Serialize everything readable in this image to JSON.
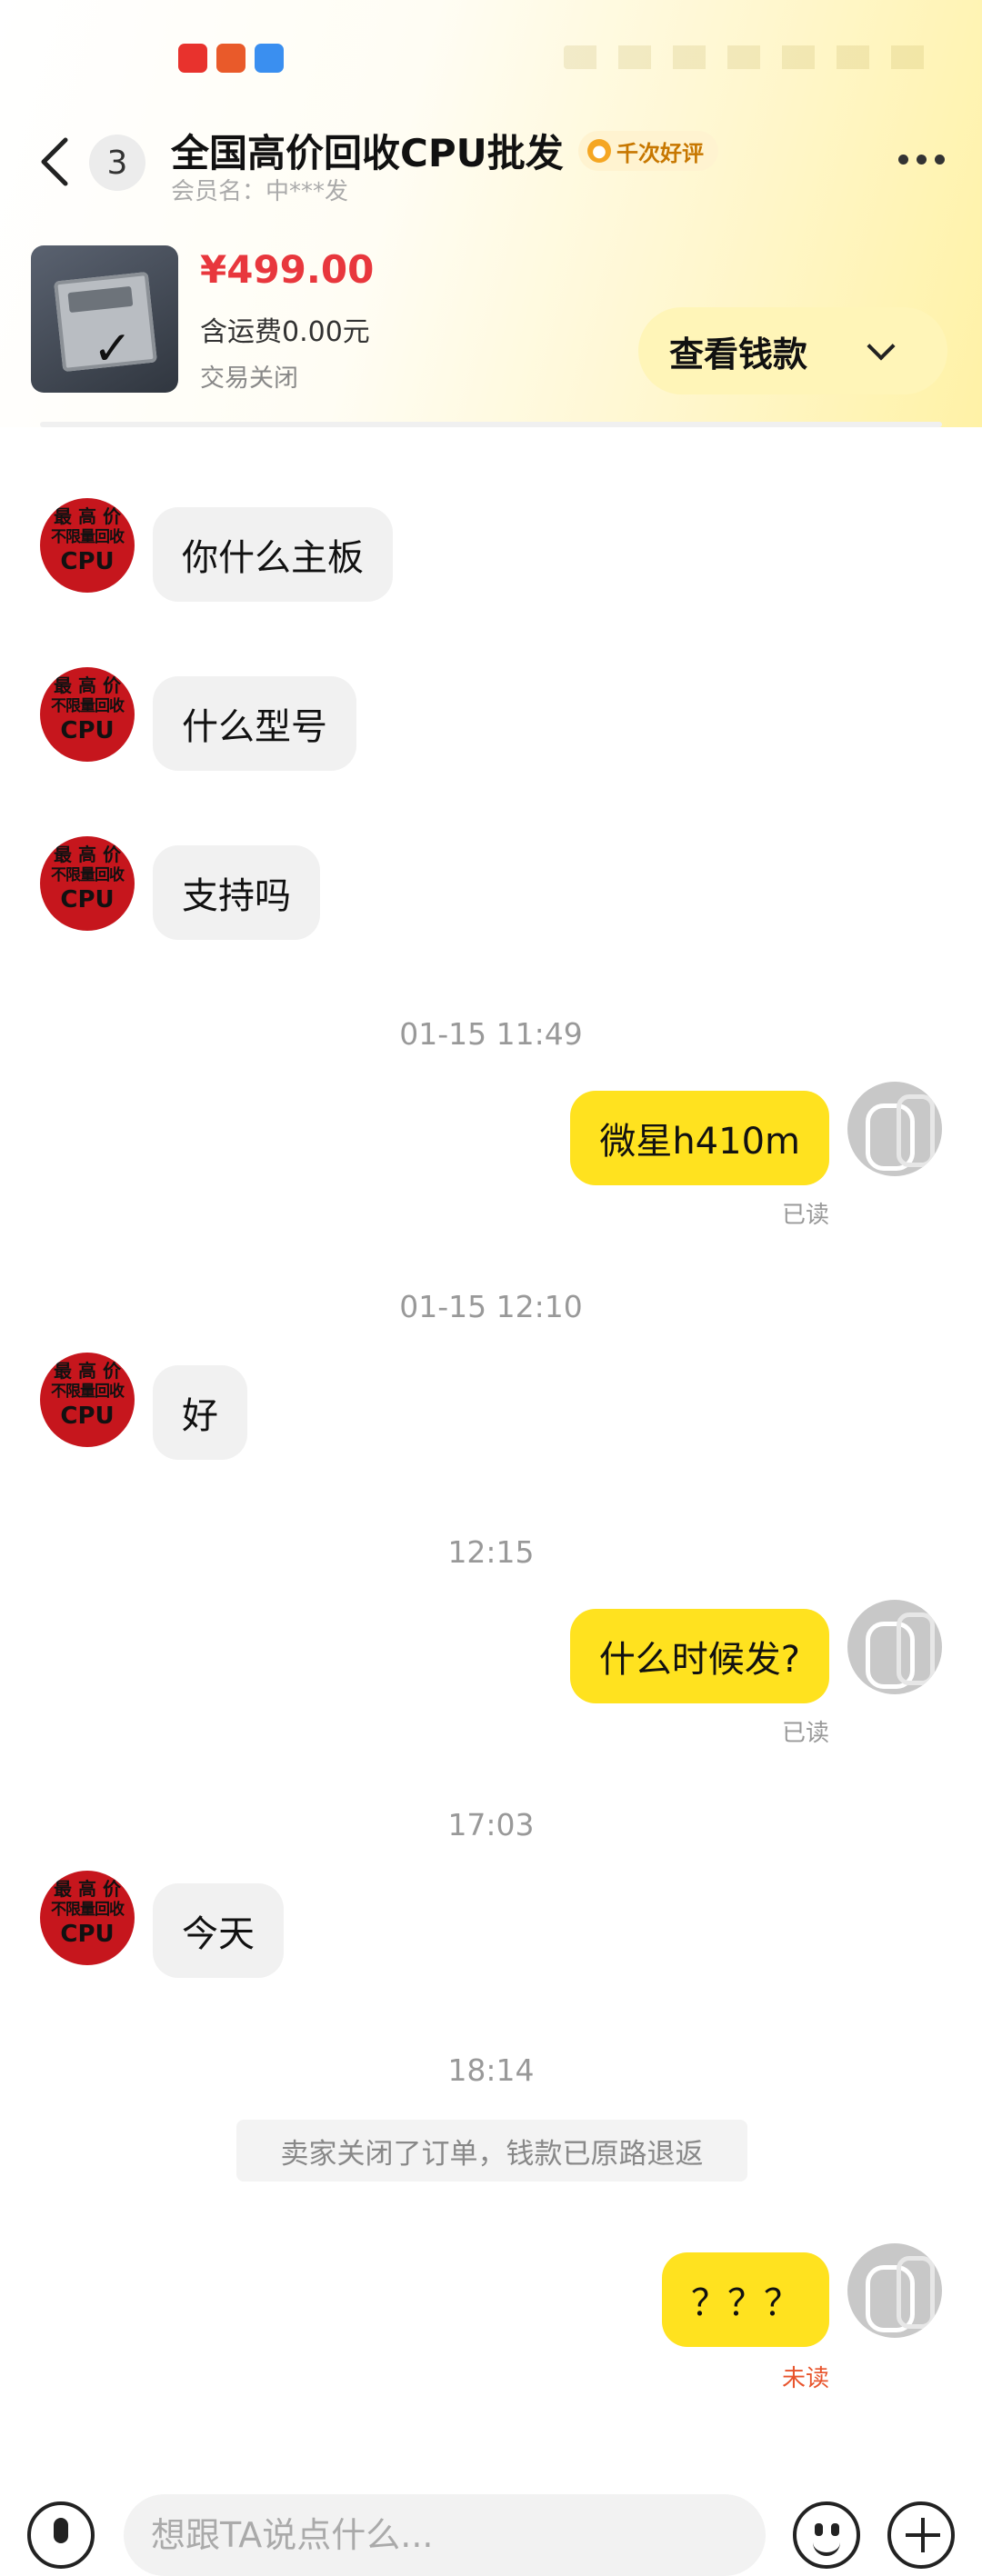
{
  "header": {
    "back_icon": "chevron-left-icon",
    "unread_count": "3",
    "title": "全国高价回收CPU批发",
    "rating_badge": "千次好评",
    "member_label": "会员名：中***发",
    "more_icon": "more-dots-icon"
  },
  "product": {
    "price": "¥499.00",
    "shipping": "含运费0.00元",
    "status": "交易关闭",
    "view_button": "查看钱款"
  },
  "seller_avatar": {
    "line1": "最 高 价",
    "line2": "不限量回收",
    "line3": "CPU"
  },
  "messages": {
    "m1": "你什么主板",
    "m2": "什么型号",
    "m3": "支持吗",
    "t1": "01-15 11:49",
    "m4": "微星h410m",
    "r1": "已读",
    "t2": "01-15 12:10",
    "m5": "好",
    "t3": "12:15",
    "m6": "什么时候发?",
    "r2": "已读",
    "t4": "17:03",
    "m7": "今天",
    "t5": "18:14",
    "system": "卖家关闭了订单，钱款已原路退返",
    "m8": "？？？",
    "r3": "未读"
  },
  "input": {
    "placeholder": "想跟TA说点什么..."
  },
  "colors": {
    "accent_yellow": "#ffe21f",
    "price_red": "#e8373d",
    "unread_orange": "#e8542c"
  }
}
